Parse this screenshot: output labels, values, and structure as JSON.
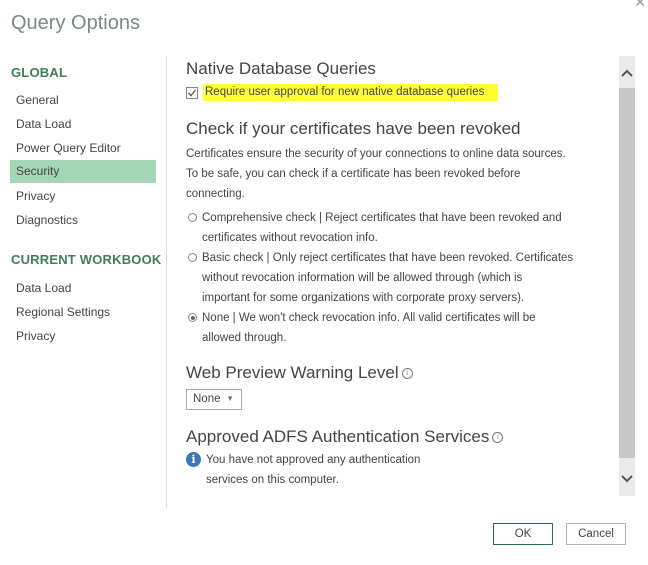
{
  "dialog": {
    "title": "Query Options",
    "close_icon": "close-icon"
  },
  "sidebar": {
    "global_heading": "GLOBAL",
    "global_items": [
      {
        "label": "General",
        "active": false
      },
      {
        "label": "Data Load",
        "active": false
      },
      {
        "label": "Power Query Editor",
        "active": false
      },
      {
        "label": "Security",
        "active": true
      },
      {
        "label": "Privacy",
        "active": false
      },
      {
        "label": "Diagnostics",
        "active": false
      }
    ],
    "workbook_heading": "CURRENT WORKBOOK",
    "workbook_items": [
      {
        "label": "Data Load"
      },
      {
        "label": "Regional Settings"
      },
      {
        "label": "Privacy"
      }
    ],
    "active_color": "#a4d6b6",
    "heading_color": "#3f7d5a"
  },
  "content": {
    "native_queries": {
      "heading": "Native Database Queries",
      "checkbox_label": "Require user approval for new native database queries",
      "checked": true,
      "highlight_color": "#ffff33"
    },
    "revocation": {
      "heading": "Check if your certificates have been revoked",
      "description_line1": "Certificates ensure the security of your connections to online data sources.",
      "description_line2": "To be safe, you can check if a certificate has been revoked before",
      "description_line3": "connecting.",
      "options": [
        {
          "line1": "Comprehensive check | Reject certificates that have been revoked and",
          "line2": "certificates without revocation info.",
          "line3": "",
          "selected": false
        },
        {
          "line1": "Basic check | Only reject certificates that have been revoked. Certificates",
          "line2": "without revocation information will be allowed through (which is",
          "line3": "important for some organizations with corporate proxy servers).",
          "selected": false
        },
        {
          "line1": "None | We won't check revocation info. All valid certificates will be",
          "line2": "allowed through.",
          "line3": "",
          "selected": true
        }
      ]
    },
    "web_preview": {
      "heading": "Web Preview Warning Level",
      "info_icon": "info-icon",
      "selected_value": "None",
      "caret": "▼"
    },
    "adfs": {
      "heading": "Approved ADFS Authentication Services",
      "info_icon": "info-icon",
      "message_line1": "You have not approved any authentication",
      "message_line2": "services on this computer.",
      "message_icon": "i"
    }
  },
  "scrollbar": {
    "up_arrow": "︿",
    "down_arrow": "﹀"
  },
  "footer": {
    "ok_label": "OK",
    "cancel_label": "Cancel",
    "ok_border_color": "#2f6e4c"
  }
}
